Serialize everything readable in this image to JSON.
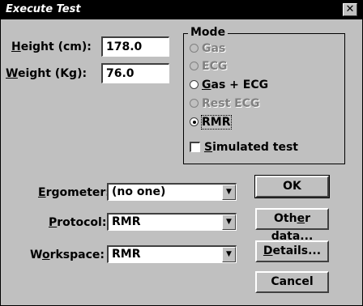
{
  "window": {
    "title": "Execute Test",
    "close_glyph": "✕"
  },
  "fields": {
    "height": {
      "label_mnemonic": "H",
      "label_rest": "eight (cm):",
      "value": "178.0"
    },
    "weight": {
      "label_mnemonic": "W",
      "label_rest": "eight (Kg):",
      "value": "76.0"
    }
  },
  "mode": {
    "title": "Mode",
    "options": [
      {
        "label": "Gas",
        "enabled": false,
        "selected": false
      },
      {
        "label": "ECG",
        "enabled": false,
        "selected": false
      },
      {
        "label_mnemonic": "G",
        "label_rest": "as + ECG",
        "enabled": true,
        "selected": false
      },
      {
        "label": "Rest ECG",
        "enabled": false,
        "selected": false
      },
      {
        "label": "RMR",
        "enabled": true,
        "selected": true
      }
    ],
    "simulated": {
      "label_mnemonic": "S",
      "label_rest": "imulated test",
      "checked": false
    }
  },
  "selects": {
    "ergometer": {
      "label_mnemonic": "E",
      "label_rest": "rgometer:",
      "value": "(no one)"
    },
    "protocol": {
      "label_mnemonic": "P",
      "label_rest": "rotocol:",
      "value": "RMR"
    },
    "workspace": {
      "label_pre": "W",
      "label_mnemonic": "o",
      "label_rest": "rkspace:",
      "value": "RMR"
    }
  },
  "buttons": {
    "ok": "OK",
    "other_pre": "Oth",
    "other_mnemonic": "e",
    "other_rest": "r data...",
    "details_mnemonic": "D",
    "details_rest": "etails...",
    "cancel": "Cancel"
  },
  "icons": {
    "dropdown_arrow": "▼"
  }
}
